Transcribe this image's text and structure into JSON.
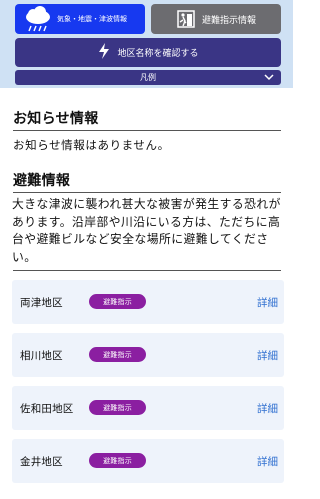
{
  "top_menu": {
    "weather_button": "気象・地震・津波情報",
    "evacuation_button": "避難指示情報",
    "area_name_button": "地区名称を確認する",
    "legend_label": "凡例"
  },
  "notice": {
    "title": "お知らせ情報",
    "message": "お知らせ情報はありません。"
  },
  "evacuation": {
    "title": "避難情報",
    "message": "大きな津波に襲われ甚大な被害が発生する恐れがあります。沿岸部や川沿にいる方は、ただちに高台や避難ビルなど安全な場所に避難してください。",
    "areas": [
      {
        "name": "両津地区",
        "status": "避難指示",
        "detail": "詳細"
      },
      {
        "name": "相川地区",
        "status": "避難指示",
        "detail": "詳細"
      },
      {
        "name": "佐和田地区",
        "status": "避難指示",
        "detail": "詳細"
      },
      {
        "name": "金井地区",
        "status": "避難指示",
        "detail": "詳細"
      }
    ]
  },
  "colors": {
    "weather_button": "#1739f0",
    "evacuation_button": "#6c6c70",
    "area_button": "#3a3585",
    "badge": "#8b1fa1",
    "link": "#2f6fd0",
    "card_bg": "#eef3fb"
  },
  "icons": [
    "cloud-rain-icon",
    "evacuation-icon",
    "lightning-icon",
    "chevron-down-icon"
  ]
}
